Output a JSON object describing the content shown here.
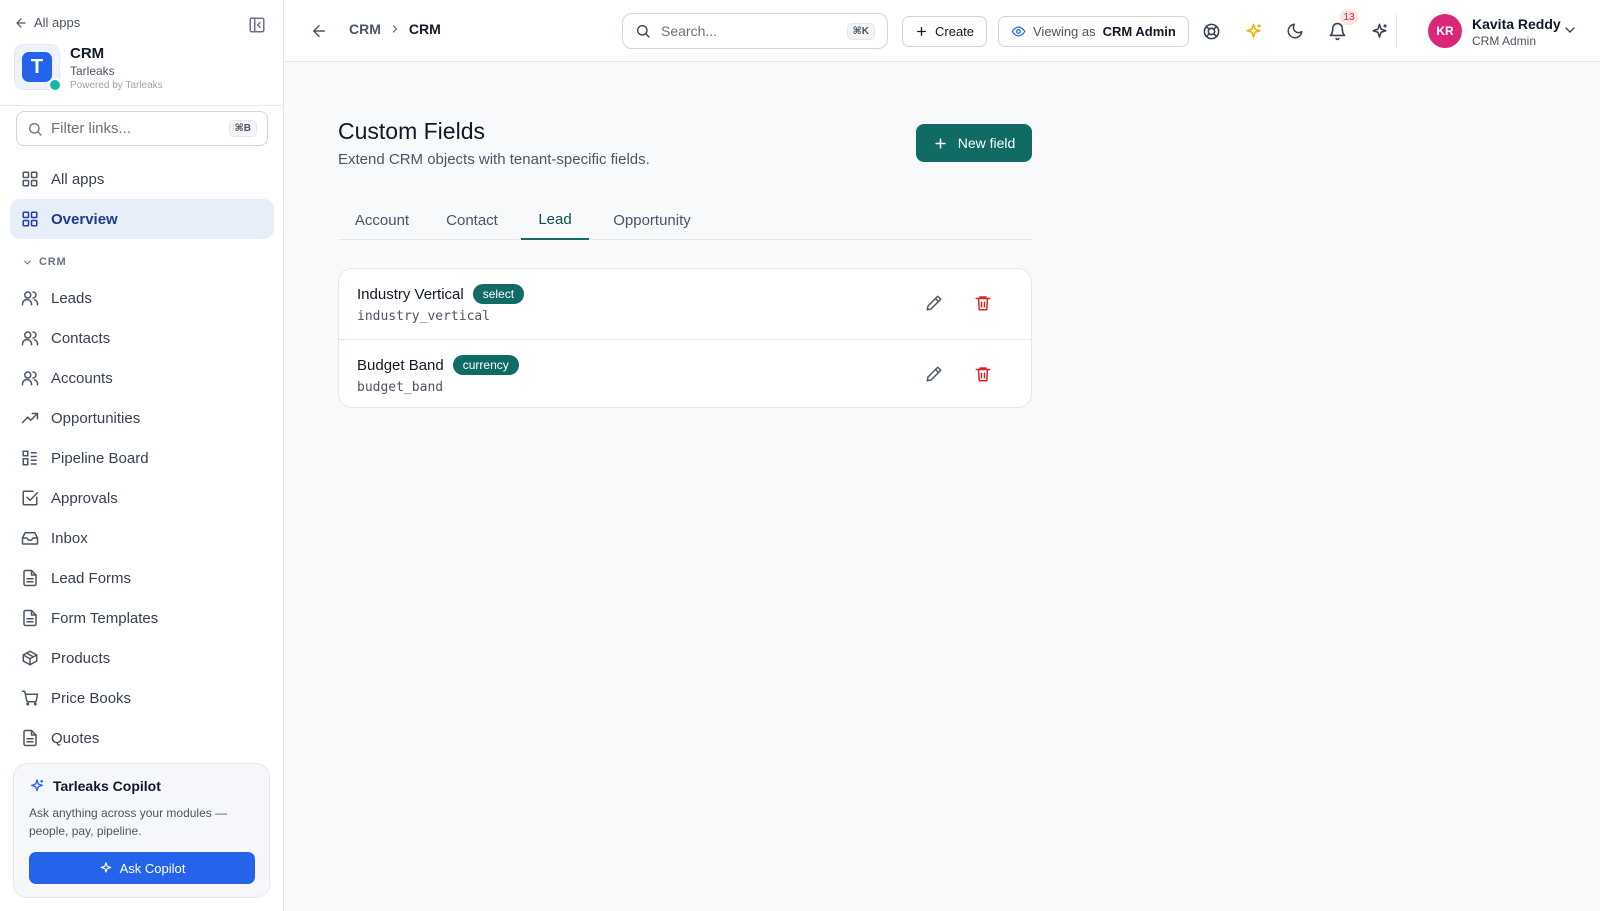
{
  "colors": {
    "primary": "#0f6b64",
    "sidebar_active_bg": "#e7eef9",
    "copilot_button": "#2563eb",
    "avatar_bg": "#db2777",
    "delete": "#dc2626"
  },
  "sidebar": {
    "back_label": "All apps",
    "brand": {
      "title": "CRM",
      "org": "Tarleaks",
      "powered": "Powered by Tarleaks",
      "logo_letter": "T"
    },
    "filter": {
      "placeholder": "Filter links...",
      "shortcut": "⌘B"
    },
    "top_items": [
      {
        "label": "All apps",
        "icon": "grid-icon"
      },
      {
        "label": "Overview",
        "icon": "grid-icon",
        "active": true
      }
    ],
    "section": "CRM",
    "items": [
      {
        "label": "Leads",
        "icon": "users-icon"
      },
      {
        "label": "Contacts",
        "icon": "users-icon"
      },
      {
        "label": "Accounts",
        "icon": "users-icon"
      },
      {
        "label": "Opportunities",
        "icon": "trending-up-icon"
      },
      {
        "label": "Pipeline Board",
        "icon": "kanban-icon"
      },
      {
        "label": "Approvals",
        "icon": "check-square-icon"
      },
      {
        "label": "Inbox",
        "icon": "inbox-icon"
      },
      {
        "label": "Lead Forms",
        "icon": "document-icon"
      },
      {
        "label": "Form Templates",
        "icon": "document-icon"
      },
      {
        "label": "Products",
        "icon": "package-icon"
      },
      {
        "label": "Price Books",
        "icon": "cart-icon"
      },
      {
        "label": "Quotes",
        "icon": "document-icon"
      }
    ],
    "copilot": {
      "title": "Tarleaks Copilot",
      "description": "Ask anything across your modules — people, pay, pipeline.",
      "button": "Ask Copilot"
    }
  },
  "topbar": {
    "breadcrumb": [
      "CRM",
      "CRM"
    ],
    "search": {
      "placeholder": "Search...",
      "shortcut": "⌘K"
    },
    "create_label": "Create",
    "viewing_as_label": "Viewing as",
    "viewing_as_role": "CRM Admin",
    "notifications_count": "13",
    "user": {
      "initials": "KR",
      "name": "Kavita Reddy",
      "role": "CRM Admin"
    }
  },
  "main": {
    "title": "Custom Fields",
    "subtitle": "Extend CRM objects with tenant-specific fields.",
    "new_button": "New field",
    "tabs": [
      {
        "label": "Account"
      },
      {
        "label": "Contact"
      },
      {
        "label": "Lead",
        "active": true
      },
      {
        "label": "Opportunity"
      }
    ],
    "fields": [
      {
        "name": "Industry Vertical",
        "type": "select",
        "key": "industry_vertical"
      },
      {
        "name": "Budget Band",
        "type": "currency",
        "key": "budget_band"
      }
    ]
  }
}
